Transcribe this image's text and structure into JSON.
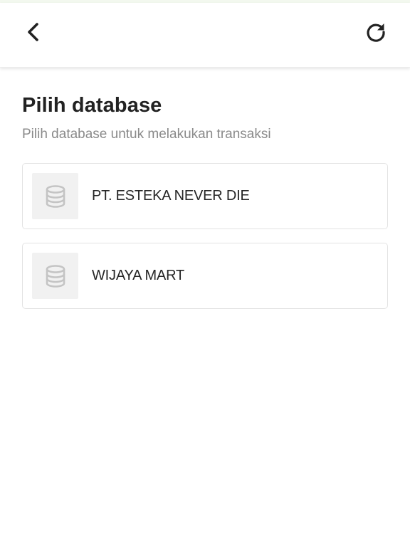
{
  "header": {
    "back_icon": "chevron-left-icon",
    "refresh_icon": "refresh-icon"
  },
  "page": {
    "title": "Pilih database",
    "subtitle": "Pilih database untuk melakukan transaksi"
  },
  "databases": [
    {
      "name": "PT. ESTEKA NEVER DIE",
      "icon": "database-icon"
    },
    {
      "name": "WIJAYA MART",
      "icon": "database-icon"
    }
  ],
  "colors": {
    "title": "#222222",
    "subtitle": "#8a8a8a",
    "card_border": "#e3e3e3",
    "thumb_bg": "#f1f1f1",
    "icon_muted": "#c4c4c4"
  }
}
